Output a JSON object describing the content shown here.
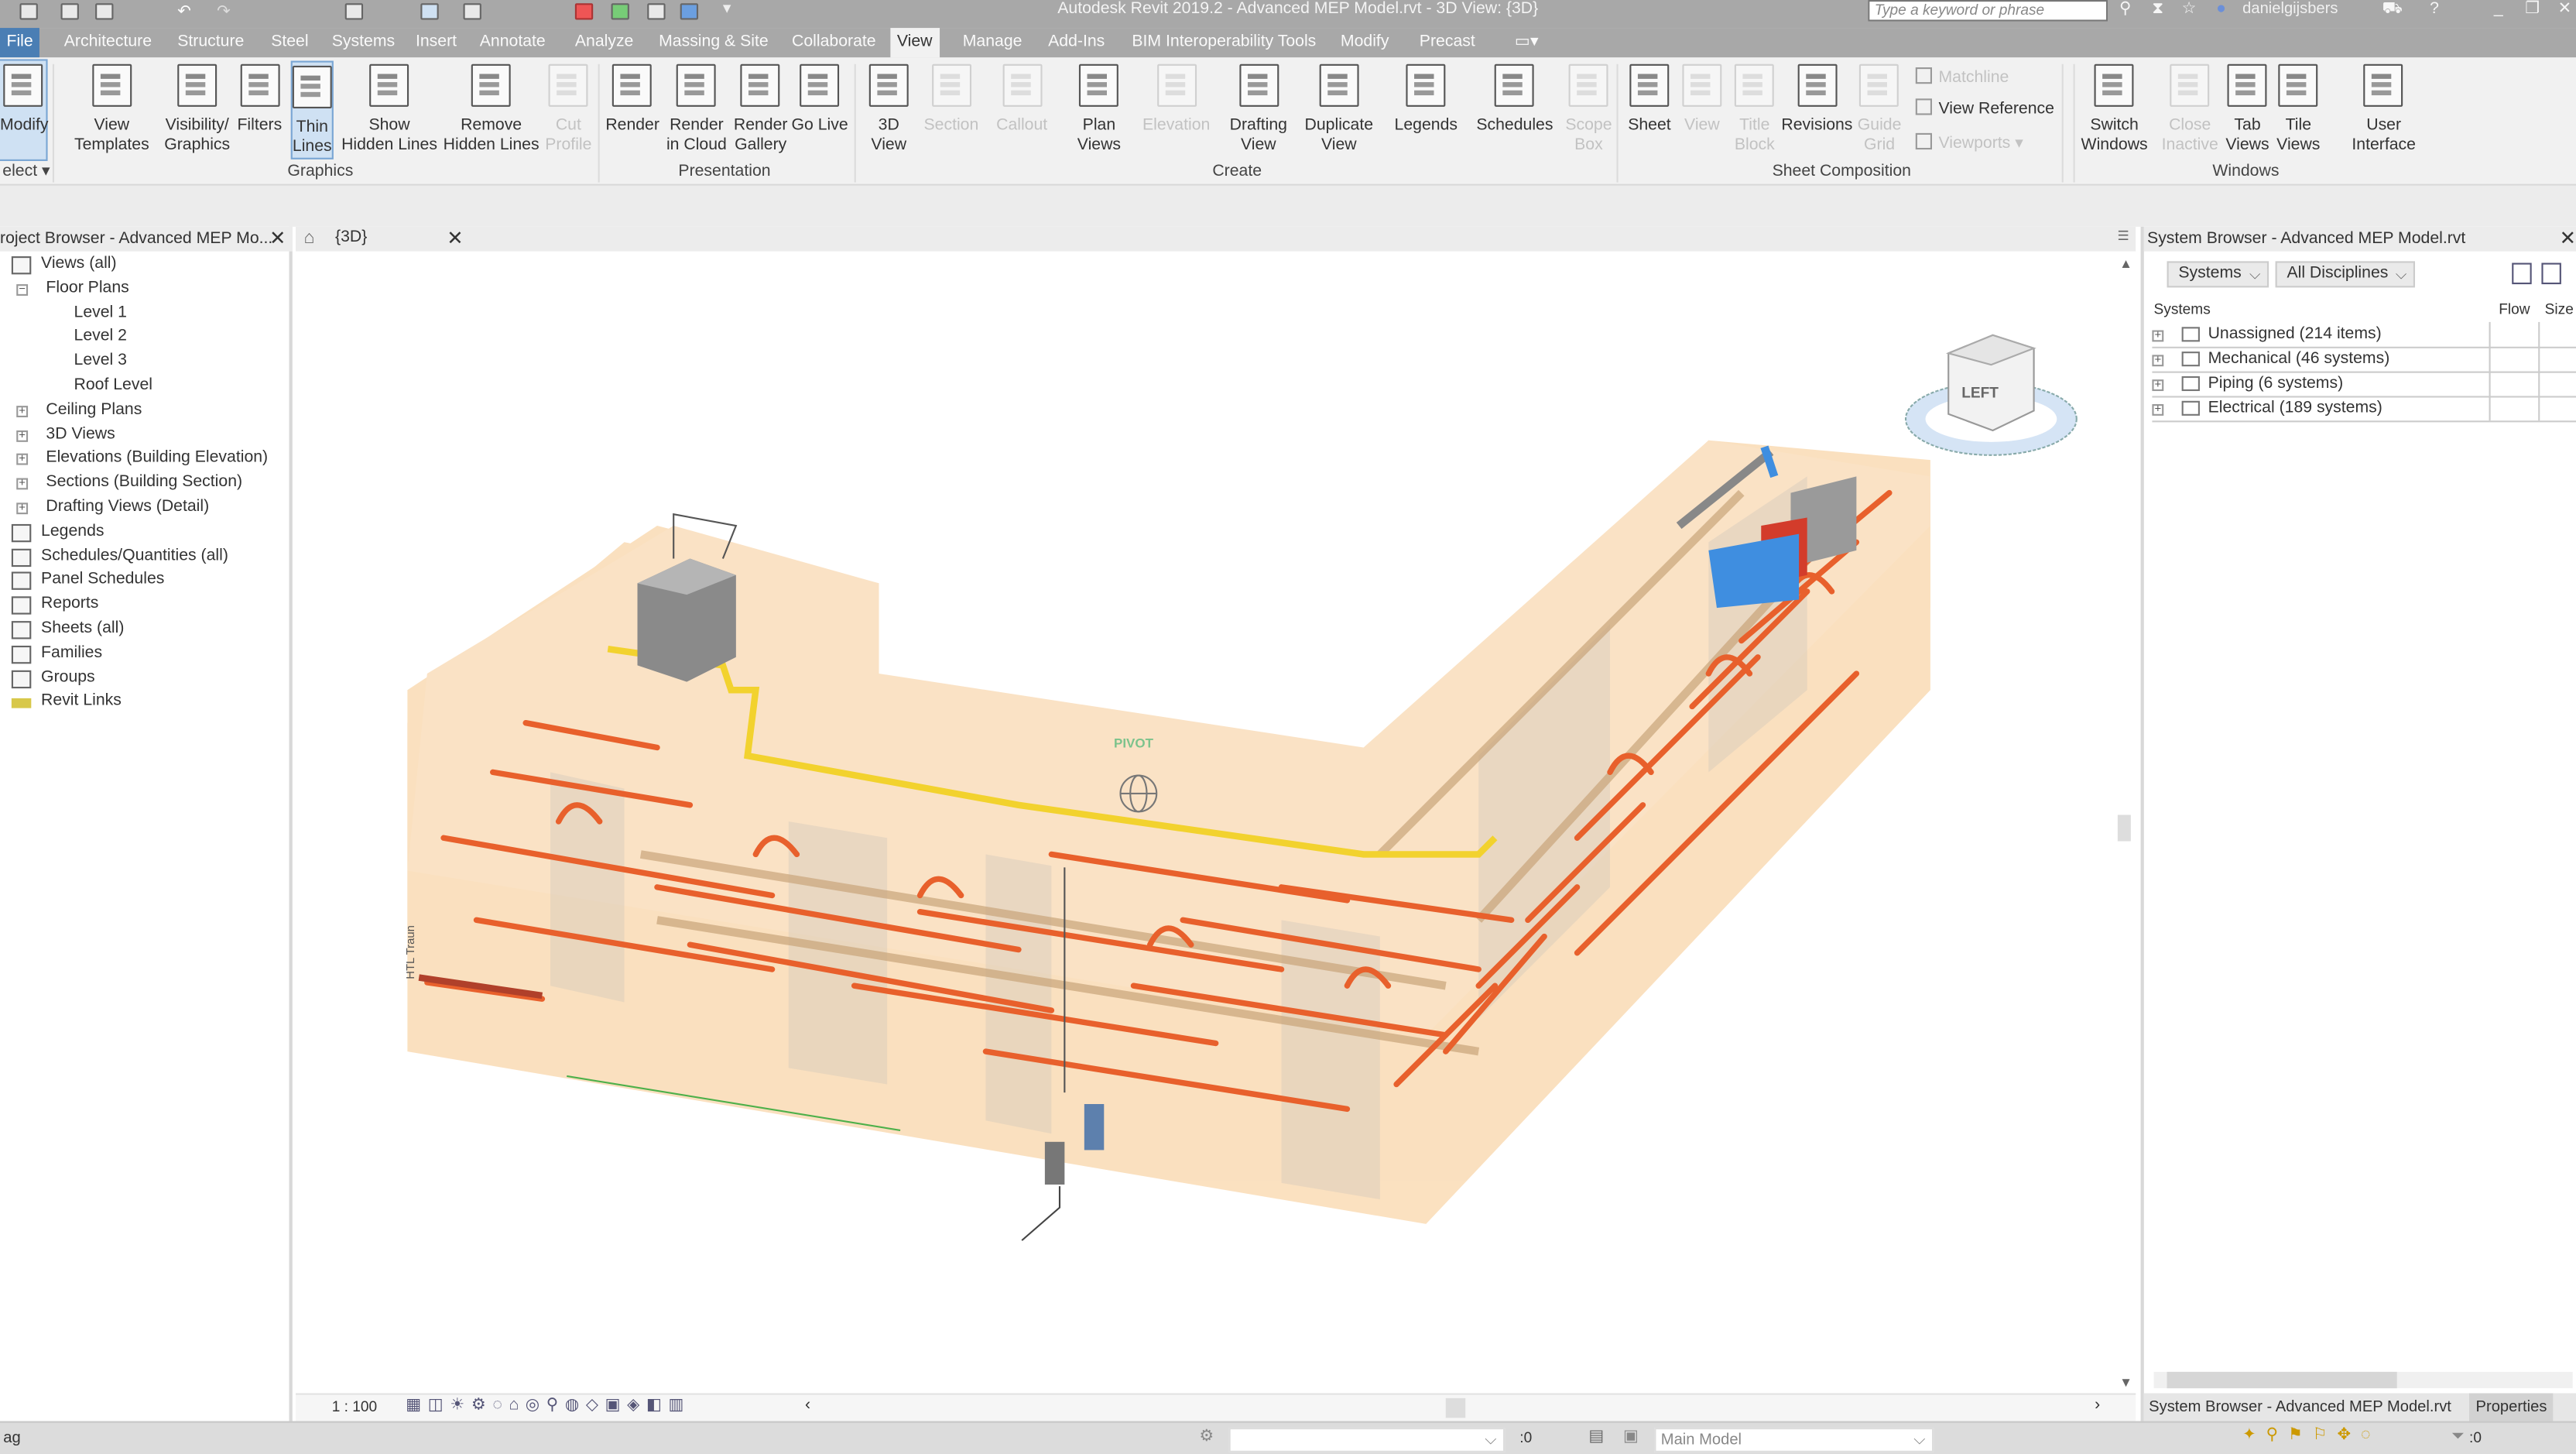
{
  "app": {
    "title": "Autodesk Revit 2019.2 - Advanced MEP Model.rvt - 3D View: {3D}",
    "search_placeholder": "Type a keyword or phrase",
    "user": "danielgijsbers"
  },
  "tabs": [
    "File",
    "Architecture",
    "Structure",
    "Steel",
    "Systems",
    "Insert",
    "Annotate",
    "Analyze",
    "Massing & Site",
    "Collaborate",
    "View",
    "Manage",
    "Add-Ins",
    "BIM Interoperability Tools",
    "Modify",
    "Precast"
  ],
  "active_tab": "View",
  "ribbon": {
    "panels": [
      "elect ▾",
      "Graphics",
      "Presentation",
      "Create",
      "Sheet Composition",
      "Windows"
    ],
    "buttons": [
      {
        "label": "Modify",
        "icon": "cursor-icon"
      },
      {
        "label": "View\nTemplates",
        "icon": "view-templates-icon"
      },
      {
        "label": "Visibility/\nGraphics",
        "icon": "visibility-graphics-icon"
      },
      {
        "label": "Filters",
        "icon": "filter-icon"
      },
      {
        "label": "Thin\nLines",
        "icon": "thin-lines-icon",
        "active": true
      },
      {
        "label": "Show\nHidden Lines",
        "icon": "show-hidden-lines-icon"
      },
      {
        "label": "Remove\nHidden Lines",
        "icon": "remove-hidden-lines-icon"
      },
      {
        "label": "Cut\nProfile",
        "icon": "cut-profile-icon",
        "disabled": true
      },
      {
        "label": "Render",
        "icon": "teapot-icon"
      },
      {
        "label": "Render\nin Cloud",
        "icon": "cloud-render-icon"
      },
      {
        "label": "Render\nGallery",
        "icon": "gallery-icon"
      },
      {
        "label": "Go Live",
        "icon": "go-live-icon"
      },
      {
        "label": "3D\nView",
        "icon": "3d-house-icon"
      },
      {
        "label": "Section",
        "icon": "section-icon",
        "disabled": true
      },
      {
        "label": "Callout",
        "icon": "callout-icon",
        "disabled": true
      },
      {
        "label": "Plan\nViews",
        "icon": "plan-views-icon"
      },
      {
        "label": "Elevation",
        "icon": "elevation-icon",
        "disabled": true
      },
      {
        "label": "Drafting\nView",
        "icon": "drafting-view-icon"
      },
      {
        "label": "Duplicate\nView",
        "icon": "duplicate-view-icon"
      },
      {
        "label": "Legends",
        "icon": "legends-icon"
      },
      {
        "label": "Schedules",
        "icon": "schedules-icon"
      },
      {
        "label": "Scope\nBox",
        "icon": "scope-box-icon",
        "disabled": true
      },
      {
        "label": "Sheet",
        "icon": "sheet-icon"
      },
      {
        "label": "View",
        "icon": "place-view-icon",
        "disabled": true
      },
      {
        "label": "Title\nBlock",
        "icon": "title-block-icon",
        "disabled": true
      },
      {
        "label": "Revisions",
        "icon": "revisions-icon"
      },
      {
        "label": "Guide\nGrid",
        "icon": "guide-grid-icon",
        "disabled": true
      },
      {
        "label": "Switch\nWindows",
        "icon": "switch-windows-icon"
      },
      {
        "label": "Close\nInactive",
        "icon": "close-inactive-icon",
        "disabled": true
      },
      {
        "label": "Tab\nViews",
        "icon": "tab-views-icon"
      },
      {
        "label": "Tile\nViews",
        "icon": "tile-views-icon"
      },
      {
        "label": "User\nInterface",
        "icon": "user-interface-icon"
      }
    ],
    "small": [
      {
        "label": "Matchline",
        "disabled": true
      },
      {
        "label": "View  Reference"
      },
      {
        "label": "Viewports ▾",
        "disabled": true
      }
    ]
  },
  "project_browser": {
    "title": "roject Browser - Advanced MEP Mo...",
    "items": [
      {
        "label": "Views (all)",
        "level": 0
      },
      {
        "label": "Floor Plans",
        "level": 1,
        "expanded": true
      },
      {
        "label": "Level 1",
        "level": 2
      },
      {
        "label": "Level 2",
        "level": 2
      },
      {
        "label": "Level 3",
        "level": 2
      },
      {
        "label": "Roof Level",
        "level": 2
      },
      {
        "label": "Ceiling Plans",
        "level": 1
      },
      {
        "label": "3D Views",
        "level": 1
      },
      {
        "label": "Elevations (Building Elevation)",
        "level": 1
      },
      {
        "label": "Sections (Building Section)",
        "level": 1
      },
      {
        "label": "Drafting Views (Detail)",
        "level": 1
      },
      {
        "label": "Legends",
        "level": 0
      },
      {
        "label": "Schedules/Quantities (all)",
        "level": 0
      },
      {
        "label": "Panel Schedules",
        "level": 0
      },
      {
        "label": "Reports",
        "level": 0
      },
      {
        "label": "Sheets (all)",
        "level": 0
      },
      {
        "label": "Families",
        "level": 0
      },
      {
        "label": "Groups",
        "level": 0
      },
      {
        "label": "Revit Links",
        "level": 0
      }
    ]
  },
  "view": {
    "tab": "{3D}",
    "pivot": "PIVOT",
    "viewcube": "LEFT",
    "annotation": "HTL Traun",
    "scale": "1 : 100"
  },
  "system_browser": {
    "title": "System Browser - Advanced MEP Model.rvt",
    "filter1": "Systems",
    "filter2": "All Disciplines",
    "columns": [
      "Systems",
      "Flow",
      "Size"
    ],
    "rows": [
      "Unassigned (214 items)",
      "Mechanical (46 systems)",
      "Piping (6 systems)",
      "Electrical (189 systems)"
    ],
    "bottom_tabs": [
      "System Browser - Advanced MEP Model.rvt",
      "Properties"
    ]
  },
  "status": {
    "left": "ag",
    "workset_count": ":0",
    "model": "Main Model",
    "filter_count": ":0"
  },
  "colors": {
    "file_tab": "#4a7eb4",
    "pipe": "#e8602c",
    "yellow_pipe": "#f2d22e",
    "floor": "#f7d3a3",
    "equipment_blue": "#3f8ee0"
  }
}
